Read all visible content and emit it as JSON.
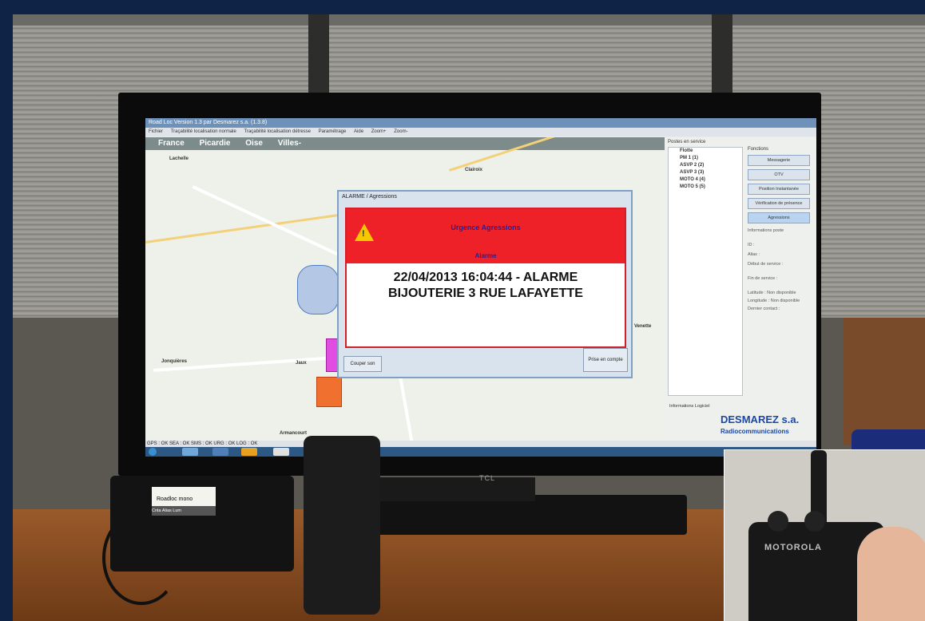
{
  "app": {
    "title": "Road Loc Version 1.3 par Desmarez s.a. (1.3.8)",
    "menu": [
      "Fichier",
      "Traçabilité localisation normale",
      "Traçabilité localisation détresse",
      "Paramétrage",
      "Aide",
      "Zoom+",
      "Zoom-"
    ]
  },
  "map": {
    "nav": [
      "France",
      "Picardie",
      "Oise",
      "Villes-"
    ],
    "towns": [
      "Lachelle",
      "Clairoix",
      "Jonquières",
      "Jaux",
      "Armancourt",
      "Venette"
    ]
  },
  "sidebar": {
    "fleet_title": "Postes en service",
    "fleet_root": "Flotte",
    "units": [
      "PM 1 (1)",
      "ASVP 2 (2)",
      "ASVP 3 (3)",
      "MOTO 4 (4)",
      "MOTO 5 (5)"
    ],
    "functions_title": "Fonctions",
    "buttons": [
      "Messagerie",
      "OTV",
      "Position Instantanée",
      "Vérification de présence",
      "Agressions"
    ],
    "info_title": "Informations poste",
    "info_rows": [
      "ID :",
      "Alias :",
      "Début de service :",
      "Fin de service :",
      "Latitude : Non disponible",
      "Longitude : Non disponible",
      "Dernier contact :"
    ],
    "log_title": "Informations Logiciel",
    "brand": "DESMAREZ s.a.",
    "brand_sub": "Radiocommunications"
  },
  "status": {
    "text": "GPS : OK  SEA : OK  SMS : OK  URG : OK  LOG : OK"
  },
  "dialog": {
    "title": "ALARME / Agressions",
    "heading": "Urgence Agressions",
    "subheading": "Alarme",
    "message_line1": "22/04/2013 16:04:44 - ALARME",
    "message_line2": "BIJOUTERIE 3 RUE LAFAYETTE",
    "btn_mute": "Couper son",
    "btn_ack": "Prise en compte"
  },
  "tv": {
    "brand": "TCL"
  },
  "radio": {
    "line1": "Roadloc mono",
    "softkeys": "Cnta  Alias  Lum"
  },
  "inset": {
    "brand": "MOTOROLA"
  },
  "colors": {
    "alarm_red": "#ee2028",
    "brand_blue": "#1a47a8",
    "frame": "#0f2347"
  }
}
